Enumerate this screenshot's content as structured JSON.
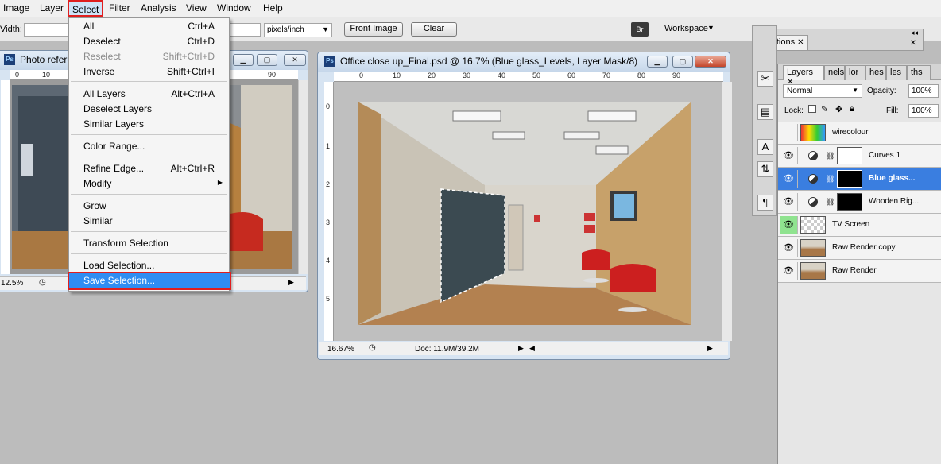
{
  "menubar": {
    "items": [
      "Image",
      "Layer",
      "Select",
      "Filter",
      "Analysis",
      "View",
      "Window",
      "Help"
    ]
  },
  "options": {
    "width_label": "Vidth:",
    "resolution_units": "pixels/inch",
    "front_image": "Front Image",
    "clear": "Clear",
    "bridge_icon": "Br",
    "workspace": "Workspace"
  },
  "select_menu": {
    "all": {
      "label": "All",
      "shortcut": "Ctrl+A"
    },
    "deselect": {
      "label": "Deselect",
      "shortcut": "Ctrl+D"
    },
    "reselect": {
      "label": "Reselect",
      "shortcut": "Shift+Ctrl+D"
    },
    "inverse": {
      "label": "Inverse",
      "shortcut": "Shift+Ctrl+I"
    },
    "all_layers": {
      "label": "All Layers",
      "shortcut": "Alt+Ctrl+A"
    },
    "deselect_layers": {
      "label": "Deselect Layers"
    },
    "similar_layers": {
      "label": "Similar Layers"
    },
    "color_range": {
      "label": "Color Range..."
    },
    "refine_edge": {
      "label": "Refine Edge...",
      "shortcut": "Alt+Ctrl+R"
    },
    "modify": {
      "label": "Modify"
    },
    "grow": {
      "label": "Grow"
    },
    "similar": {
      "label": "Similar"
    },
    "transform_selection": {
      "label": "Transform Selection"
    },
    "load_selection": {
      "label": "Load Selection..."
    },
    "save_selection": {
      "label": "Save Selection..."
    }
  },
  "photo_window": {
    "title": "Photo referer",
    "zoom": "12.5%",
    "ruler": [
      "0",
      "10",
      "90"
    ]
  },
  "doc_window": {
    "title": "Office close up_Final.psd @ 16.7% (Blue glass_Levels, Layer Mask/8)",
    "zoom": "16.67%",
    "doc_info": "Doc: 11.9M/39.2M",
    "ruler_h": [
      "0",
      "10",
      "20",
      "30",
      "40",
      "50",
      "60",
      "70",
      "80",
      "90"
    ],
    "ruler_v": [
      "0",
      "1",
      "2",
      "3",
      "4",
      "5"
    ]
  },
  "actions": {
    "tab": "Actions"
  },
  "layers": {
    "tabs": [
      "Layers",
      "nels",
      "lor",
      "hes",
      "les",
      "ths"
    ],
    "blend_mode": "Normal",
    "opacity_label": "Opacity:",
    "opacity": "100%",
    "lock_label": "Lock:",
    "fill_label": "Fill:",
    "fill": "100%",
    "rows": [
      {
        "name": "wirecolour"
      },
      {
        "name": "Curves 1"
      },
      {
        "name": "Blue glass..."
      },
      {
        "name": "Wooden Rig..."
      },
      {
        "name": "TV Screen"
      },
      {
        "name": "Raw Render copy"
      },
      {
        "name": "Raw Render"
      }
    ]
  }
}
